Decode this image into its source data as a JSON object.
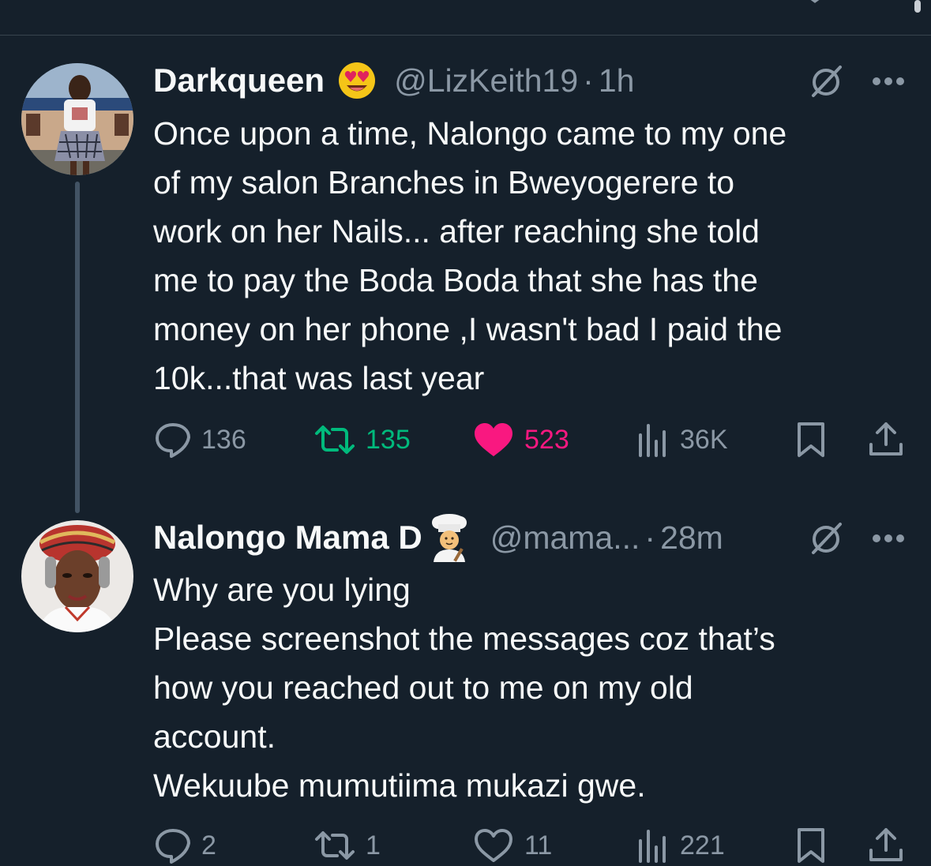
{
  "colors": {
    "background": "#15202b",
    "text_primary": "#f7f9f9",
    "text_secondary": "#8b98a5",
    "retweet_active": "#00ba7c",
    "like_active": "#f91880",
    "divider": "#38444d"
  },
  "tweets": [
    {
      "display_name": "Darkqueen",
      "name_emoji_icon": "heart-eyes-emoji-icon",
      "handle": "@LizKeith19",
      "dot": "·",
      "time": "1h",
      "lines": [
        "Once upon a time, Nalongo came to my one",
        "of my salon Branches in Bweyogerere to",
        "work on her Nails... after reaching she told",
        "me to pay the Boda Boda that she has the",
        "money on her phone ,I wasn't bad I paid the",
        "10k...that was last year"
      ],
      "replies": "136",
      "retweets": "135",
      "likes": "523",
      "views": "36K",
      "retweeted": true,
      "liked": true
    },
    {
      "display_name": "Nalongo Mama D",
      "name_emoji_icon": "chef-emoji-icon",
      "handle": "@mama...",
      "dot": "·",
      "time": "28m",
      "lines": [
        "Why are you lying",
        "Please screenshot the messages coz that’s",
        "how you reached out to me on my old",
        "account.",
        "Wekuube mumutiima mukazi gwe."
      ],
      "replies": "2",
      "retweets": "1",
      "likes": "11",
      "views": "221",
      "retweeted": false,
      "liked": false
    }
  ]
}
